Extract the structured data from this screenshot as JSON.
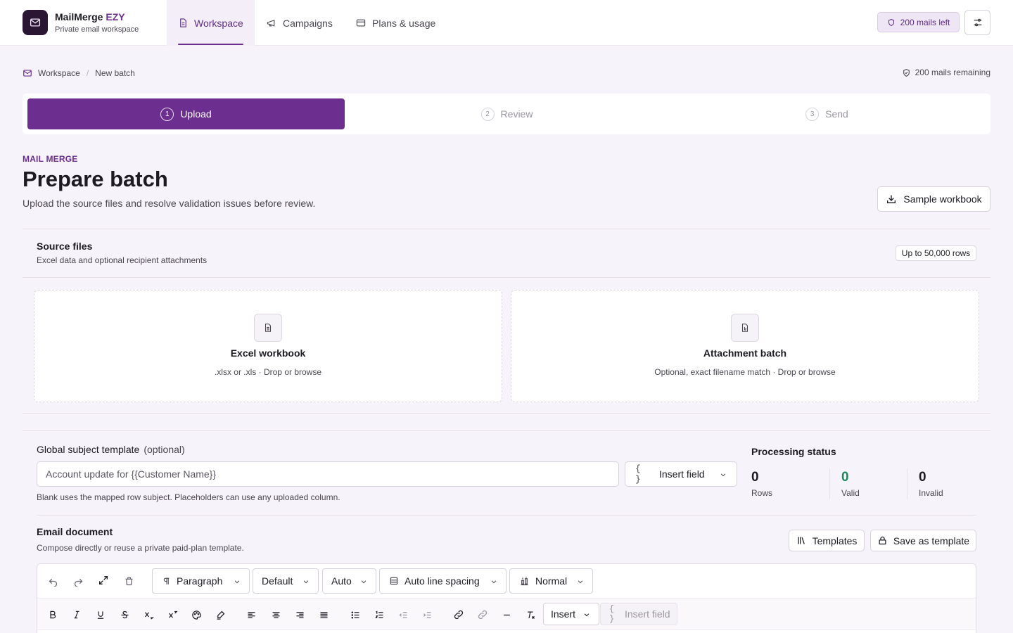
{
  "app": {
    "name": "MailMerge",
    "name_accent": "EZY",
    "tagline": "Private email workspace"
  },
  "nav": {
    "tabs": [
      {
        "label": "Workspace",
        "icon": "document-icon",
        "active": true
      },
      {
        "label": "Campaigns",
        "icon": "megaphone-icon",
        "active": false
      },
      {
        "label": "Plans & usage",
        "icon": "credit-card-icon",
        "active": false
      }
    ],
    "mails_left": "200 mails left"
  },
  "breadcrumb": {
    "items": [
      "Workspace",
      "New batch"
    ],
    "remaining": "200 mails remaining"
  },
  "stepper": {
    "steps": [
      {
        "number": "1",
        "label": "Upload",
        "active": true
      },
      {
        "number": "2",
        "label": "Review",
        "active": false
      },
      {
        "number": "3",
        "label": "Send",
        "active": false
      }
    ]
  },
  "header": {
    "eyebrow": "MAIL MERGE",
    "title": "Prepare batch",
    "subtitle": "Upload the source files and resolve validation issues before review.",
    "sample_button": "Sample workbook"
  },
  "source_files": {
    "title": "Source files",
    "subtitle": "Excel data and optional recipient attachments",
    "badge": "Up to 50,000 rows",
    "excel": {
      "title": "Excel workbook",
      "subtitle": ".xlsx or .xls · Drop or browse"
    },
    "attachments": {
      "title": "Attachment batch",
      "subtitle": "Optional, exact filename match · Drop or browse"
    }
  },
  "subject": {
    "label": "Global subject template",
    "optional": "(optional)",
    "placeholder": "Account update for {{Customer Name}}",
    "insert_field": "Insert field",
    "help": "Blank uses the mapped row subject. Placeholders can use any uploaded column."
  },
  "processing": {
    "title": "Processing status",
    "stats": [
      {
        "value": "0",
        "label": "Rows"
      },
      {
        "value": "0",
        "label": "Valid"
      },
      {
        "value": "0",
        "label": "Invalid"
      }
    ]
  },
  "email_document": {
    "title": "Email document",
    "subtitle": "Compose directly or reuse a private paid-plan template.",
    "templates_button": "Templates",
    "save_template_button": "Save as template"
  },
  "toolbar": {
    "block_style": "Paragraph",
    "font": "Default",
    "size": "Auto",
    "line_spacing": "Auto line spacing",
    "spacing": "Normal",
    "insert": "Insert",
    "insert_field": "Insert field"
  },
  "colors": {
    "accent": "#6c2e8f",
    "valid": "#1a8a5a",
    "background": "#f7f3fa"
  }
}
